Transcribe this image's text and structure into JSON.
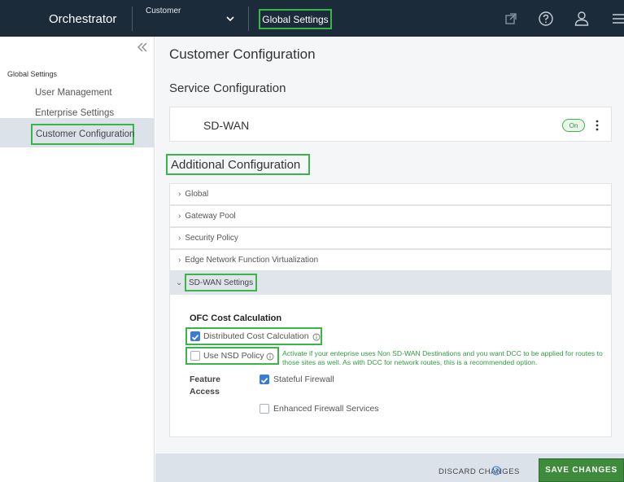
{
  "topbar": {
    "brand": "Orchestrator",
    "customer_label": "Customer",
    "global_settings_label": "Global Settings",
    "icons": [
      "external-link-icon",
      "help-icon",
      "user-icon",
      "menu-icon"
    ]
  },
  "sidebar": {
    "section_title": "Global Settings",
    "items": [
      {
        "label": "User Management"
      },
      {
        "label": "Enterprise Settings"
      },
      {
        "label": "Customer Configuration"
      }
    ],
    "active_item": "Customer Configuration"
  },
  "main": {
    "page_title": "Customer Configuration",
    "service_title": "Service Configuration",
    "sdwan": {
      "title": "SD-WAN",
      "toggle_label": "On"
    },
    "additional_title": "Additional Configuration",
    "sections": [
      {
        "label": "Global"
      },
      {
        "label": "Gateway Pool"
      },
      {
        "label": "Security Policy"
      },
      {
        "label": "Edge Network Function Virtualization"
      }
    ],
    "open_section": "SD-WAN Settings",
    "ofc": {
      "title": "OFC Cost Calculation",
      "dcc_label": "Distributed Cost Calculation",
      "dcc_checked": true,
      "nsd_label": "Use NSD Policy",
      "nsd_checked": false,
      "note": "Activate if your enteprise uses Non SD-WAN Destinations and you want DCC to be applied for routes to those sites as well. As with DCC for network routes, this is a recommended option."
    },
    "feature_access": {
      "label": "Feature Access",
      "stateful_label": "Stateful Firewall",
      "stateful_checked": true,
      "enhanced_label": "Enhanced Firewall Services",
      "enhanced_checked": false
    }
  },
  "footer": {
    "discard_label": "DISCARD CHANGES",
    "save_label": "SAVE CHANGES"
  },
  "colors": {
    "topbar_bg": "#1c2b39",
    "highlight_green": "#3ab54a",
    "save_green": "#3e8c3b",
    "checkbox_blue": "#3a7bd5",
    "note_green": "#2e9f3f"
  }
}
